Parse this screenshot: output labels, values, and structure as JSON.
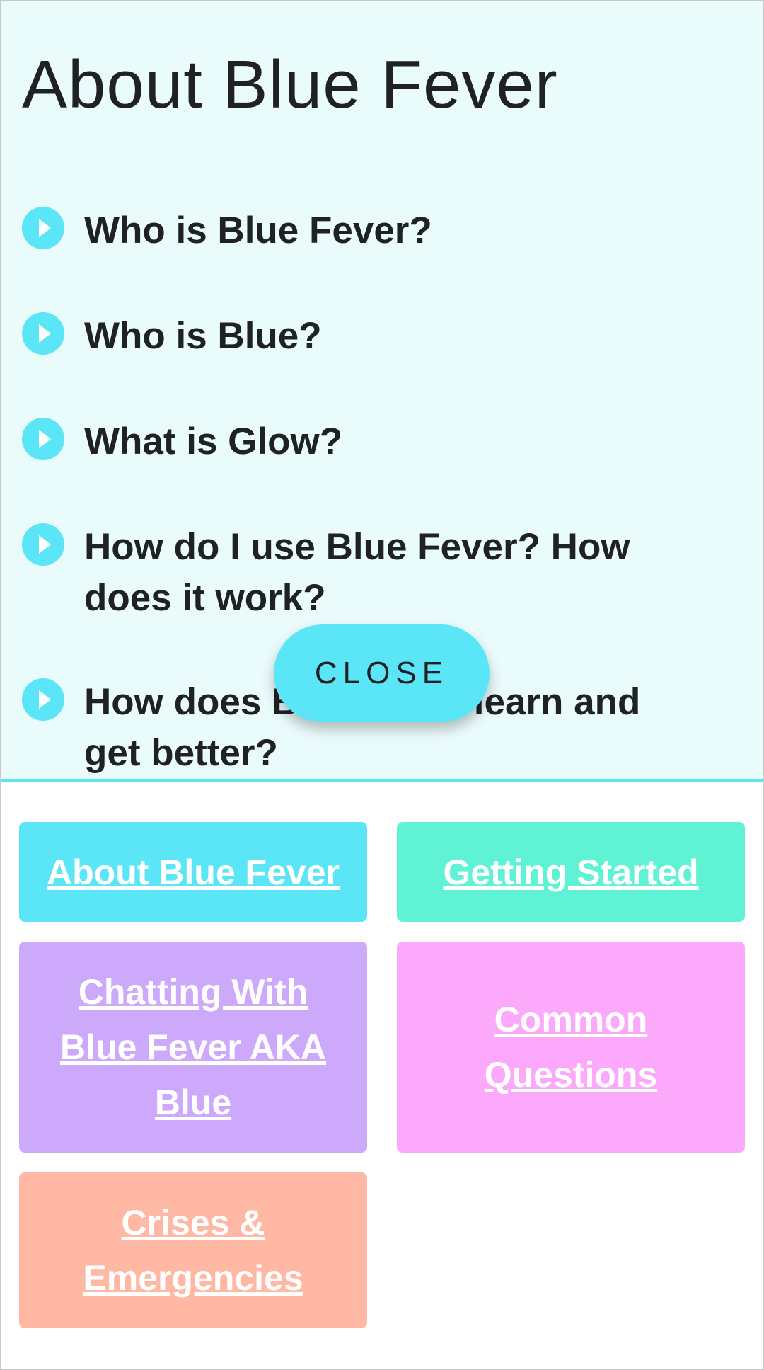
{
  "faq": {
    "title": "About Blue Fever",
    "questions": [
      "Who is Blue Fever?",
      "Who is Blue?",
      "What is Glow?",
      "How do I use Blue Fever? How does it work?",
      "How does Blue Fever learn and get better?"
    ]
  },
  "close_button": {
    "label": "CLOSE"
  },
  "tiles": [
    {
      "label": "About Blue Fever",
      "color": "#5be6f7"
    },
    {
      "label": "Getting Started",
      "color": "#5ff2d5"
    },
    {
      "label": "Chatting With Blue Fever AKA Blue",
      "color": "#cda9fc"
    },
    {
      "label": "Common Questions",
      "color": "#fca9fb"
    },
    {
      "label": "Crises & Emergencies",
      "color": "#ffb8a4"
    }
  ],
  "colors": {
    "accent": "#5be6f7",
    "panel_background": "#eafbfc",
    "text": "#1f2124"
  },
  "icons": {
    "question_bullet": "play-circle-icon"
  }
}
